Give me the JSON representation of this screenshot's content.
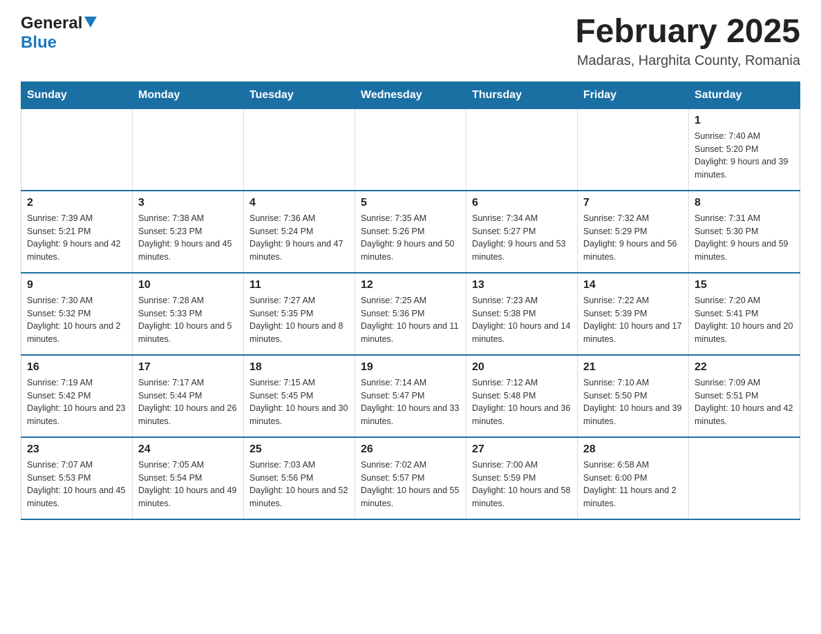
{
  "header": {
    "logo_general": "General",
    "logo_blue": "Blue",
    "title": "February 2025",
    "subtitle": "Madaras, Harghita County, Romania"
  },
  "calendar": {
    "days_of_week": [
      "Sunday",
      "Monday",
      "Tuesday",
      "Wednesday",
      "Thursday",
      "Friday",
      "Saturday"
    ],
    "weeks": [
      [
        {
          "day": "",
          "info": ""
        },
        {
          "day": "",
          "info": ""
        },
        {
          "day": "",
          "info": ""
        },
        {
          "day": "",
          "info": ""
        },
        {
          "day": "",
          "info": ""
        },
        {
          "day": "",
          "info": ""
        },
        {
          "day": "1",
          "info": "Sunrise: 7:40 AM\nSunset: 5:20 PM\nDaylight: 9 hours and 39 minutes."
        }
      ],
      [
        {
          "day": "2",
          "info": "Sunrise: 7:39 AM\nSunset: 5:21 PM\nDaylight: 9 hours and 42 minutes."
        },
        {
          "day": "3",
          "info": "Sunrise: 7:38 AM\nSunset: 5:23 PM\nDaylight: 9 hours and 45 minutes."
        },
        {
          "day": "4",
          "info": "Sunrise: 7:36 AM\nSunset: 5:24 PM\nDaylight: 9 hours and 47 minutes."
        },
        {
          "day": "5",
          "info": "Sunrise: 7:35 AM\nSunset: 5:26 PM\nDaylight: 9 hours and 50 minutes."
        },
        {
          "day": "6",
          "info": "Sunrise: 7:34 AM\nSunset: 5:27 PM\nDaylight: 9 hours and 53 minutes."
        },
        {
          "day": "7",
          "info": "Sunrise: 7:32 AM\nSunset: 5:29 PM\nDaylight: 9 hours and 56 minutes."
        },
        {
          "day": "8",
          "info": "Sunrise: 7:31 AM\nSunset: 5:30 PM\nDaylight: 9 hours and 59 minutes."
        }
      ],
      [
        {
          "day": "9",
          "info": "Sunrise: 7:30 AM\nSunset: 5:32 PM\nDaylight: 10 hours and 2 minutes."
        },
        {
          "day": "10",
          "info": "Sunrise: 7:28 AM\nSunset: 5:33 PM\nDaylight: 10 hours and 5 minutes."
        },
        {
          "day": "11",
          "info": "Sunrise: 7:27 AM\nSunset: 5:35 PM\nDaylight: 10 hours and 8 minutes."
        },
        {
          "day": "12",
          "info": "Sunrise: 7:25 AM\nSunset: 5:36 PM\nDaylight: 10 hours and 11 minutes."
        },
        {
          "day": "13",
          "info": "Sunrise: 7:23 AM\nSunset: 5:38 PM\nDaylight: 10 hours and 14 minutes."
        },
        {
          "day": "14",
          "info": "Sunrise: 7:22 AM\nSunset: 5:39 PM\nDaylight: 10 hours and 17 minutes."
        },
        {
          "day": "15",
          "info": "Sunrise: 7:20 AM\nSunset: 5:41 PM\nDaylight: 10 hours and 20 minutes."
        }
      ],
      [
        {
          "day": "16",
          "info": "Sunrise: 7:19 AM\nSunset: 5:42 PM\nDaylight: 10 hours and 23 minutes."
        },
        {
          "day": "17",
          "info": "Sunrise: 7:17 AM\nSunset: 5:44 PM\nDaylight: 10 hours and 26 minutes."
        },
        {
          "day": "18",
          "info": "Sunrise: 7:15 AM\nSunset: 5:45 PM\nDaylight: 10 hours and 30 minutes."
        },
        {
          "day": "19",
          "info": "Sunrise: 7:14 AM\nSunset: 5:47 PM\nDaylight: 10 hours and 33 minutes."
        },
        {
          "day": "20",
          "info": "Sunrise: 7:12 AM\nSunset: 5:48 PM\nDaylight: 10 hours and 36 minutes."
        },
        {
          "day": "21",
          "info": "Sunrise: 7:10 AM\nSunset: 5:50 PM\nDaylight: 10 hours and 39 minutes."
        },
        {
          "day": "22",
          "info": "Sunrise: 7:09 AM\nSunset: 5:51 PM\nDaylight: 10 hours and 42 minutes."
        }
      ],
      [
        {
          "day": "23",
          "info": "Sunrise: 7:07 AM\nSunset: 5:53 PM\nDaylight: 10 hours and 45 minutes."
        },
        {
          "day": "24",
          "info": "Sunrise: 7:05 AM\nSunset: 5:54 PM\nDaylight: 10 hours and 49 minutes."
        },
        {
          "day": "25",
          "info": "Sunrise: 7:03 AM\nSunset: 5:56 PM\nDaylight: 10 hours and 52 minutes."
        },
        {
          "day": "26",
          "info": "Sunrise: 7:02 AM\nSunset: 5:57 PM\nDaylight: 10 hours and 55 minutes."
        },
        {
          "day": "27",
          "info": "Sunrise: 7:00 AM\nSunset: 5:59 PM\nDaylight: 10 hours and 58 minutes."
        },
        {
          "day": "28",
          "info": "Sunrise: 6:58 AM\nSunset: 6:00 PM\nDaylight: 11 hours and 2 minutes."
        },
        {
          "day": "",
          "info": ""
        }
      ]
    ]
  }
}
